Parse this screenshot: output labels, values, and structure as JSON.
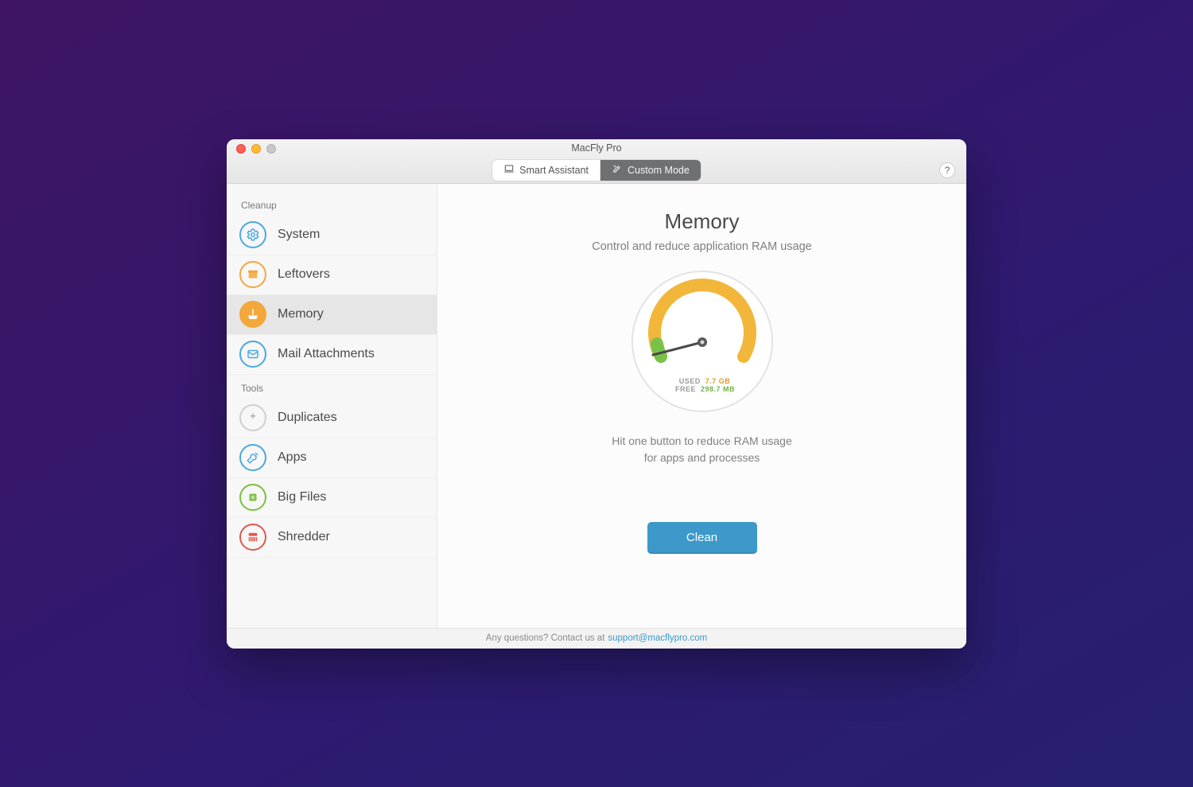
{
  "window": {
    "title": "MacFly Pro"
  },
  "toolbar": {
    "smart_assistant_label": "Smart Assistant",
    "custom_mode_label": "Custom Mode",
    "help_label": "?"
  },
  "sidebar": {
    "sections": [
      {
        "label": "Cleanup",
        "items": [
          {
            "id": "system",
            "label": "System",
            "icon": "gear-icon",
            "ring": "ring-blue",
            "selected": false
          },
          {
            "id": "leftovers",
            "label": "Leftovers",
            "icon": "box-icon",
            "ring": "ring-orange",
            "selected": false
          },
          {
            "id": "memory",
            "label": "Memory",
            "icon": "broom-icon",
            "ring": "ring-solid-orange",
            "selected": true
          },
          {
            "id": "mail",
            "label": "Mail Attachments",
            "icon": "mail-icon",
            "ring": "ring-blue",
            "selected": false
          }
        ]
      },
      {
        "label": "Tools",
        "items": [
          {
            "id": "duplicates",
            "label": "Duplicates",
            "icon": "sparkle-icon",
            "ring": "ring-gray",
            "selected": false
          },
          {
            "id": "apps",
            "label": "Apps",
            "icon": "wrench-icon",
            "ring": "ring-blue",
            "selected": false
          },
          {
            "id": "bigfiles",
            "label": "Big Files",
            "icon": "chip-icon",
            "ring": "ring-green",
            "selected": false
          },
          {
            "id": "shredder",
            "label": "Shredder",
            "icon": "shred-icon",
            "ring": "ring-red",
            "selected": false
          }
        ]
      }
    ]
  },
  "pane": {
    "title": "Memory",
    "subtitle": "Control and reduce application RAM usage",
    "gauge": {
      "used_label": "USED",
      "used_value": "7.7 GB",
      "free_label": "FREE",
      "free_value": "298.7 MB"
    },
    "hint_line1": "Hit one button to reduce RAM usage",
    "hint_line2": "for apps and processes",
    "cta_label": "Clean"
  },
  "footer": {
    "prefix": "Any questions? Contact us at ",
    "email": "support@macflypro.com"
  },
  "colors": {
    "accent_blue": "#3c99c9",
    "gauge_arc": "#f2b63a",
    "gauge_green": "#78c24a"
  }
}
